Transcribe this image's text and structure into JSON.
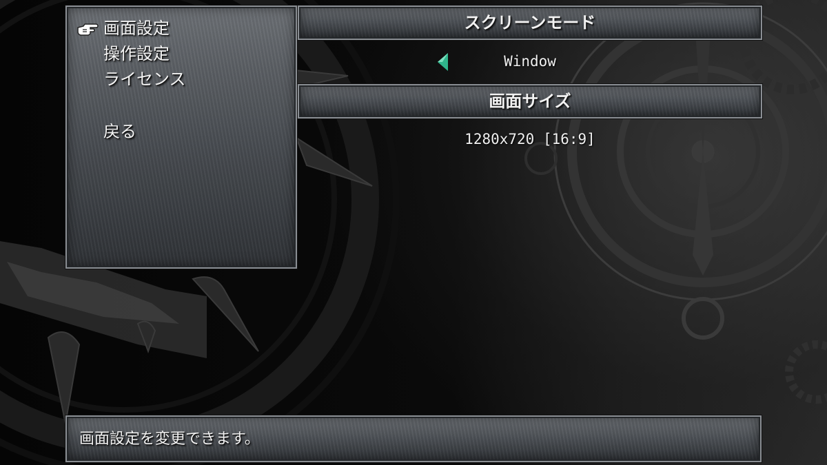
{
  "menu": {
    "items": [
      {
        "label": "画面設定",
        "selected": true
      },
      {
        "label": "操作設定",
        "selected": false
      },
      {
        "label": "ライセンス",
        "selected": false
      },
      {
        "label": "戻る",
        "selected": false
      }
    ],
    "cursor_icon": "pointing-hand-icon"
  },
  "settings": {
    "screen_mode": {
      "header": "スクリーンモード",
      "value": "Window",
      "prev_icon": "left-arrow-icon",
      "arrow_color": "#2fb58c"
    },
    "screen_size": {
      "header": "画面サイズ",
      "value": "1280x720 [16:9]"
    }
  },
  "help": {
    "text": "画面設定を変更できます。"
  },
  "colors": {
    "panel": "#5a5e63",
    "panel_border": "#8a8e93",
    "text": "#f4f4f4",
    "background": "#050505"
  }
}
